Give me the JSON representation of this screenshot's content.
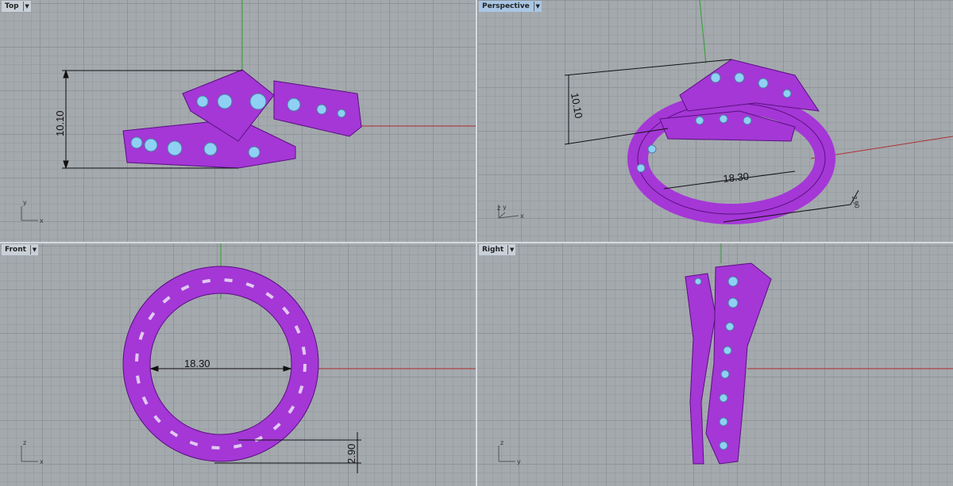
{
  "viewports": [
    {
      "label": "Top",
      "active": false,
      "dimension": "10.10",
      "axes": [
        "y",
        "x"
      ]
    },
    {
      "label": "Perspective",
      "active": true,
      "dimensions": [
        "10.10",
        "18.30",
        "2.90"
      ],
      "axes": [
        "z",
        "y",
        "x"
      ]
    },
    {
      "label": "Front",
      "active": false,
      "dimensions": [
        "18.30",
        "2.90"
      ],
      "axes": [
        "z",
        "x"
      ]
    },
    {
      "label": "Right",
      "active": false,
      "axes": [
        "z",
        "y"
      ]
    }
  ],
  "colors": {
    "model": "#a437d6",
    "gem": "#8fd0f5",
    "x_axis": "#b03030",
    "y_axis": "#2ea02e",
    "viewport_bg": "#a4a9ae"
  },
  "dropdown_icon": "triangle-down"
}
